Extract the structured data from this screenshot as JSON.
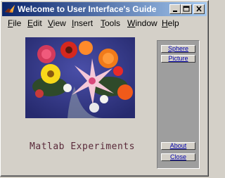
{
  "window": {
    "title": "Welcome to User Interface's Guide",
    "title_icon": "matlab-logo-icon",
    "controls": [
      "minimize-icon",
      "maximize-icon",
      "close-icon"
    ]
  },
  "menubar": {
    "items": [
      {
        "label": "File",
        "accel": "F",
        "rest": "ile"
      },
      {
        "label": "Edit",
        "accel": "E",
        "rest": "dit"
      },
      {
        "label": "View",
        "accel": "V",
        "rest": "iew"
      },
      {
        "label": "Insert",
        "accel": "I",
        "rest": "nsert"
      },
      {
        "label": "Tools",
        "accel": "T",
        "rest": "ools"
      },
      {
        "label": "Window",
        "accel": "W",
        "rest": "indow"
      },
      {
        "label": "Help",
        "accel": "H",
        "rest": "elp"
      }
    ]
  },
  "main": {
    "image": "flower-bouquet-photo",
    "caption": "Matlab Experiments"
  },
  "panel": {
    "buttons": {
      "sphere": "Sphere",
      "picture": "Picture",
      "about": "About",
      "close": "Close"
    }
  },
  "colors": {
    "title_bar_start": "#0a246a",
    "title_bar_end": "#a6caf0",
    "caption_text": "#5a2a3a",
    "button_text": "#0000aa",
    "panel_bg": "#9e9e9e",
    "window_bg": "#d4d0c8"
  }
}
